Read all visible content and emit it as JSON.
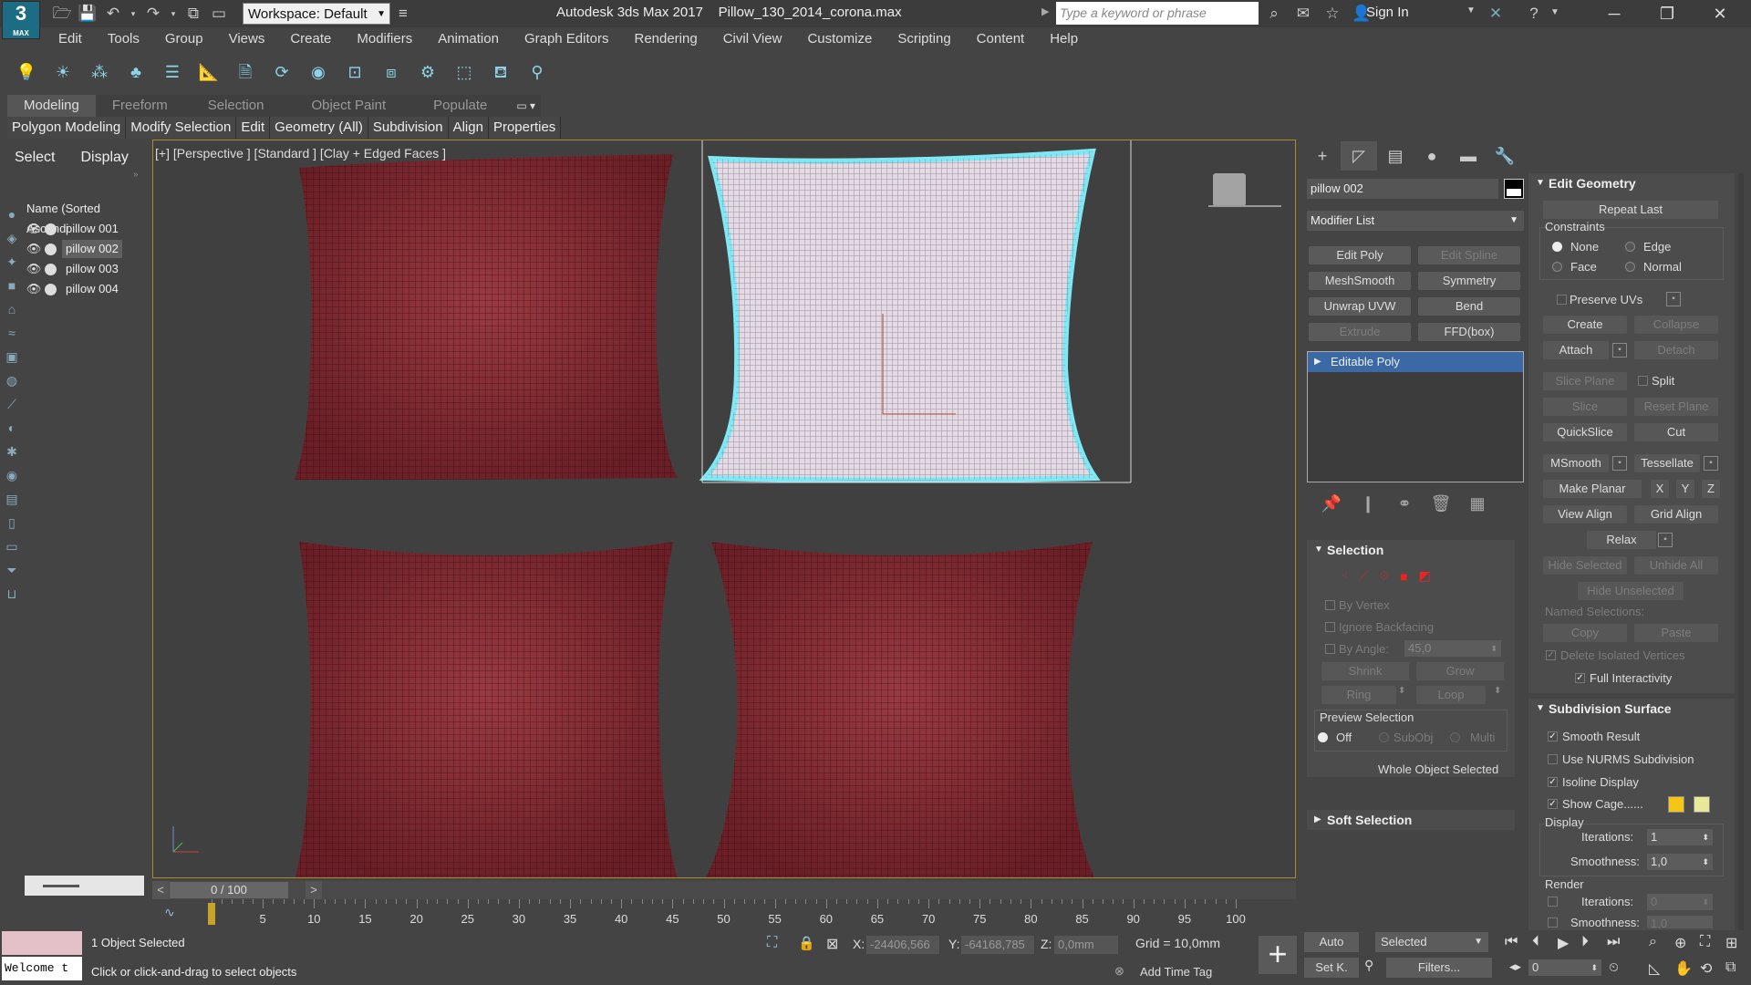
{
  "app": {
    "logo_text": "3",
    "logo_sub": "MAX",
    "workspace": "Workspace: Default",
    "title_product": "Autodesk 3ds Max 2017",
    "title_file": "Pillow_130_2014_corona.max",
    "search_placeholder": "Type a keyword or phrase",
    "sign_in": "Sign In"
  },
  "menu": [
    "Edit",
    "Tools",
    "Group",
    "Views",
    "Create",
    "Modifiers",
    "Animation",
    "Graph Editors",
    "Rendering",
    "Civil View",
    "Customize",
    "Scripting",
    "Content",
    "Help"
  ],
  "ribbon": {
    "tabs": [
      "Modeling",
      "Freeform",
      "Selection",
      "Object Paint",
      "Populate"
    ],
    "panels": [
      "Polygon Modeling",
      "Modify Selection",
      "Edit",
      "Geometry (All)",
      "Subdivision",
      "Align",
      "Properties"
    ]
  },
  "scene_explorer": {
    "tabs": [
      "Select",
      "Display"
    ],
    "header": "Name (Sorted Ascendi",
    "items": [
      "pillow 001",
      "pillow 002",
      "pillow 003",
      "pillow 004"
    ],
    "selected": "pillow 002"
  },
  "viewport": {
    "label": "[+] [Perspective ] [Standard ] [Clay + Edged Faces ]",
    "pillow_color": "#7e2a30",
    "selected_color": "#e8dde8",
    "highlight_color": "#7fe8f5"
  },
  "command_panel": {
    "object_name": "pillow 002",
    "modifier_list": "Modifier List",
    "modifier_buttons": [
      "Edit Poly",
      "Edit Spline",
      "MeshSmooth",
      "Symmetry",
      "Unwrap UVW",
      "Bend",
      "Extrude",
      "FFD(box)"
    ],
    "stack_item": "Editable Poly"
  },
  "selection_rollout": {
    "title": "Selection",
    "by_vertex": "By Vertex",
    "ignore_backfacing": "Ignore Backfacing",
    "by_angle": "By Angle:",
    "angle_value": "45,0",
    "shrink": "Shrink",
    "grow": "Grow",
    "ring": "Ring",
    "loop": "Loop",
    "preview": "Preview Selection",
    "preview_off": "Off",
    "preview_subobj": "SubObj",
    "preview_multi": "Multi",
    "status": "Whole Object Selected"
  },
  "soft_selection": "Soft Selection",
  "edit_geometry": {
    "title": "Edit Geometry",
    "repeat_last": "Repeat Last",
    "constraints": "Constraints",
    "none": "None",
    "edge": "Edge",
    "face": "Face",
    "normal": "Normal",
    "preserve_uvs": "Preserve UVs",
    "create": "Create",
    "collapse": "Collapse",
    "attach": "Attach",
    "detach": "Detach",
    "slice_plane": "Slice Plane",
    "split": "Split",
    "slice": "Slice",
    "reset_plane": "Reset Plane",
    "quickslice": "QuickSlice",
    "cut": "Cut",
    "msmooth": "MSmooth",
    "tessellate": "Tessellate",
    "make_planar": "Make Planar",
    "x": "X",
    "y": "Y",
    "z": "Z",
    "view_align": "View Align",
    "grid_align": "Grid Align",
    "relax": "Relax",
    "hide_selected": "Hide Selected",
    "unhide_all": "Unhide All",
    "hide_unselected": "Hide Unselected",
    "named_selections": "Named Selections:",
    "copy": "Copy",
    "paste": "Paste",
    "delete_isolated": "Delete Isolated Vertices",
    "full_interactivity": "Full Interactivity"
  },
  "subdivision_surface": {
    "title": "Subdivision Surface",
    "smooth_result": "Smooth Result",
    "use_nurms": "Use NURMS Subdivision",
    "isoline": "Isoline Display",
    "show_cage": "Show Cage......",
    "cage_color1": "#f5c518",
    "cage_color2": "#e8e89a",
    "display": "Display",
    "iterations_label": "Iterations:",
    "iterations": "1",
    "smoothness_label": "Smoothness:",
    "smoothness": "1,0",
    "render": "Render",
    "render_iterations": "0",
    "render_smoothness_label": "Smoothness:",
    "render_smoothness": "1,0"
  },
  "timeline": {
    "frame": "0 / 100",
    "ticks": [
      "5",
      "10",
      "15",
      "20",
      "25",
      "30",
      "35",
      "40",
      "45",
      "50",
      "55",
      "60",
      "65",
      "70",
      "75",
      "80",
      "85",
      "90",
      "95",
      "100"
    ]
  },
  "status": {
    "maxscript": "Welcome t",
    "objects": "1 Object Selected",
    "prompt": "Click or click-and-drag to select objects",
    "x_label": "X:",
    "x_value": "-24406,566",
    "y_label": "Y:",
    "y_value": "-64168,785",
    "z_label": "Z:",
    "z_value": "0,0mm",
    "grid": "Grid = 10,0mm",
    "add_time_tag": "Add Time Tag",
    "auto": "Auto",
    "set_k": "Set K.",
    "selected": "Selected",
    "filters": "Filters...",
    "current_frame": "0"
  }
}
